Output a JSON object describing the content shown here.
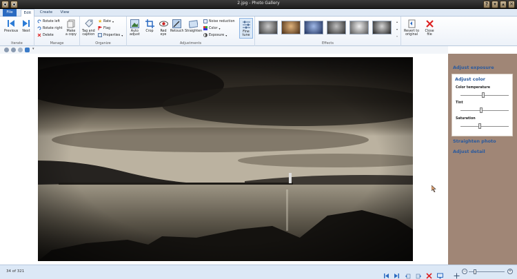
{
  "window": {
    "title": "2.jpg - Photo Gallery"
  },
  "tabs": {
    "file": "File",
    "edit": "Edit",
    "create": "Create",
    "view": "View"
  },
  "ribbon": {
    "iterate": {
      "previous": "Previous",
      "next": "Next",
      "label": "Iterate"
    },
    "manage": {
      "rotate_left": "Rotate left",
      "rotate_right": "Rotate right",
      "delete": "Delete",
      "make_copy_1": "Make",
      "make_copy_2": "a copy",
      "label": "Manage"
    },
    "organize": {
      "tag_1": "Tag and",
      "tag_2": "caption",
      "rate": "Rate",
      "flag": "Flag",
      "properties": "Properties",
      "label": "Organize"
    },
    "adjustments": {
      "auto_1": "Auto",
      "auto_2": "adjust",
      "crop": "Crop",
      "redeye_1": "Red",
      "redeye_2": "eye",
      "retouch": "Retouch",
      "straighten": "Straighten",
      "noise": "Noise reduction",
      "color": "Color",
      "exposure": "Exposure",
      "fine_1": "Fine",
      "fine_2": "tune",
      "label": "Adjustments"
    },
    "effects": {
      "label": "Effects"
    },
    "revert": {
      "line1": "Revert to",
      "line2": "original"
    },
    "close": {
      "line1": "Close",
      "line2": "file"
    }
  },
  "panel": {
    "adjust_exposure": "Adjust exposure",
    "adjust_color": "Adjust color",
    "color_temperature": "Color temperature",
    "tint": "Tint",
    "saturation": "Saturation",
    "straighten_photo": "Straighten photo",
    "adjust_detail": "Adjust detail"
  },
  "status": {
    "count": "34 of 321"
  },
  "colors": {
    "accent": "#2b6bc1",
    "panel_bg": "#a08676",
    "link": "#2a5a9e"
  }
}
